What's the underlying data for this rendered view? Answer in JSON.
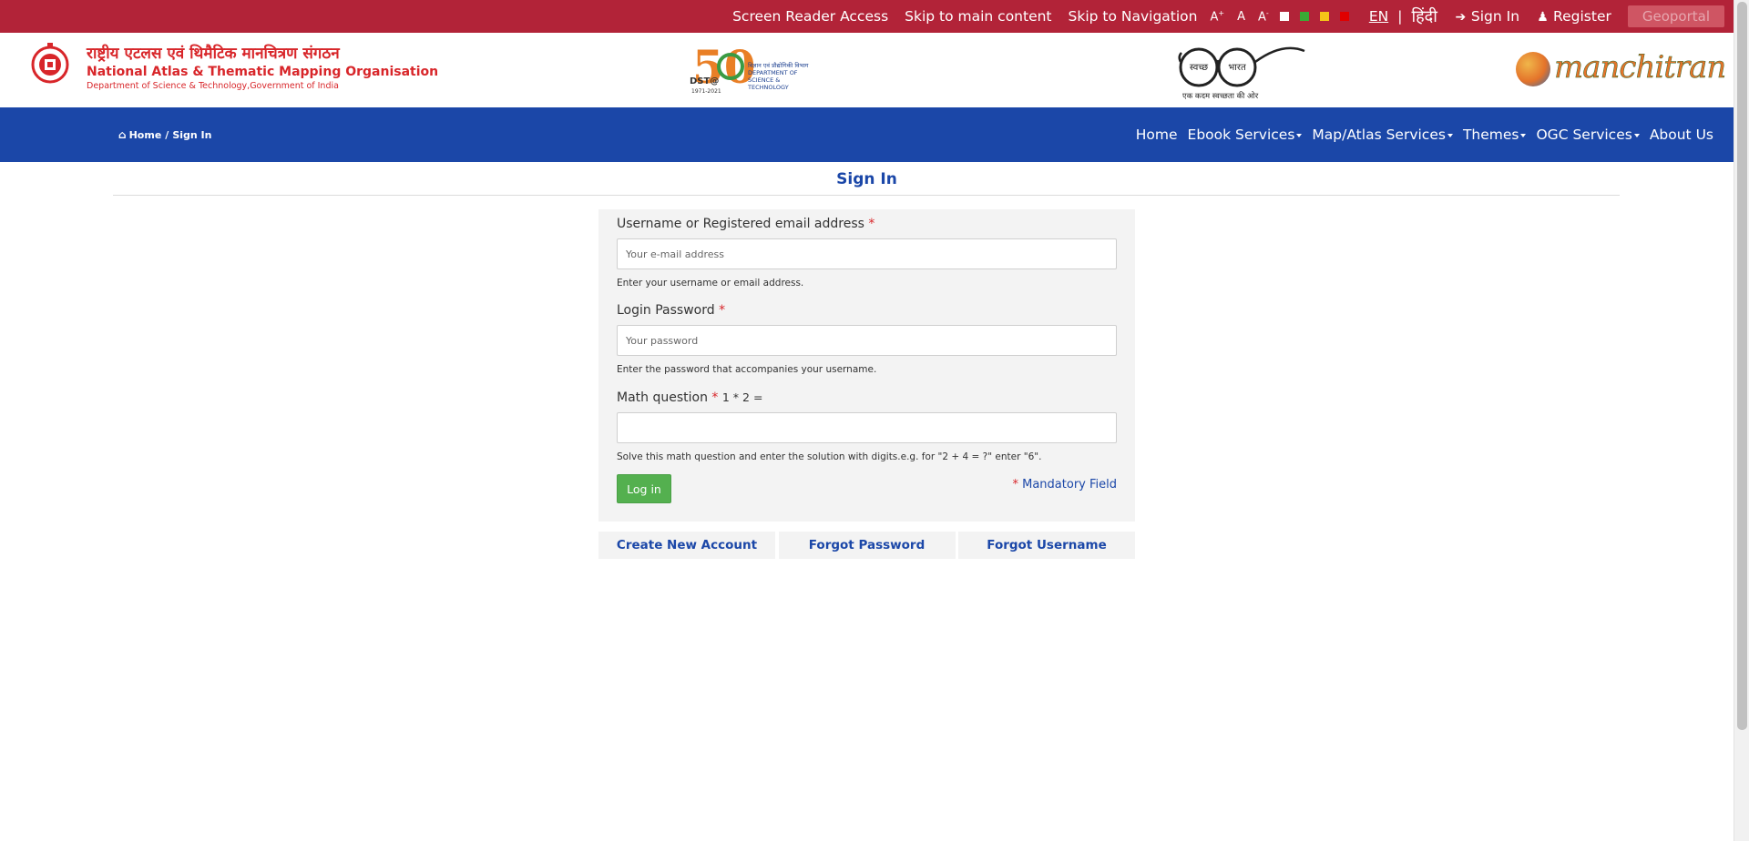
{
  "topbar": {
    "screen_reader": "Screen Reader Access",
    "skip_main": "Skip to main content",
    "skip_nav": "Skip to Navigation",
    "font_increase": "A",
    "font_increase_sup": "+",
    "font_normal": "A",
    "font_decrease": "A",
    "font_decrease_sup": "-",
    "theme_colors": [
      "#ffffff",
      "#3aaa35",
      "#f5c518",
      "#e00000"
    ],
    "lang_en": "EN",
    "lang_sep": "|",
    "lang_hi": "हिंदी",
    "sign_in": "Sign In",
    "register": "Register",
    "geoportal": "Geoportal"
  },
  "header": {
    "org_hindi": "राष्ट्रीय एटलस एवं थिमैटिक मानचित्रण संगठन",
    "org_english": "National Atlas & Thematic Mapping Organisation",
    "org_dept": "Department of Science & Technology,Government of India",
    "dst_prefix": "DST@",
    "dst_50": "50",
    "dst_years": "1971-2021",
    "dst_dept_hindi": "विज्ञान एवं प्रौद्योगिकी विभाग",
    "dst_dept_line1": "DEPARTMENT OF",
    "dst_dept_line2": "SCIENCE & TECHNOLOGY",
    "swachh_left": "स्वच्छ",
    "swachh_right": "भारत",
    "swachh_caption": "एक कदम स्वच्छता की ओर",
    "manchitran": "manchitran"
  },
  "navbar": {
    "breadcrumb_home": "Home",
    "breadcrumb_sep": "/",
    "breadcrumb_current": "Sign In",
    "items": [
      {
        "label": "Home",
        "dropdown": false
      },
      {
        "label": "Ebook Services",
        "dropdown": true
      },
      {
        "label": "Map/Atlas Services",
        "dropdown": true
      },
      {
        "label": "Themes",
        "dropdown": true
      },
      {
        "label": "OGC Services",
        "dropdown": true
      },
      {
        "label": "About Us",
        "dropdown": false
      }
    ]
  },
  "page": {
    "title": "Sign In"
  },
  "form": {
    "username_label": "Username or Registered email address",
    "username_placeholder": "Your e-mail address",
    "username_value": "",
    "username_help": "Enter your username or email address.",
    "password_label": "Login Password",
    "password_placeholder": "Your password",
    "password_value": "",
    "password_help": "Enter the password that accompanies your username.",
    "math_label": "Math question",
    "math_question": "1 * 2 =",
    "math_value": "",
    "math_help": "Solve this math question and enter the solution with digits.e.g. for \"2 + 4 = ?\" enter \"6\".",
    "required_mark": "*",
    "login_button": "Log in",
    "mandatory_text": "Mandatory Field"
  },
  "links": {
    "create_account": "Create New Account",
    "forgot_password": "Forgot Password",
    "forgot_username": "Forgot Username"
  },
  "colors": {
    "topbar_bg": "#b22338",
    "navbar_bg": "#1b47a8",
    "login_button": "#54b04f",
    "required": "#d8262a",
    "link": "#1b47a8"
  },
  "icons": {
    "sign_in": "sign-in-icon",
    "register": "user-icon",
    "home": "home-icon"
  }
}
